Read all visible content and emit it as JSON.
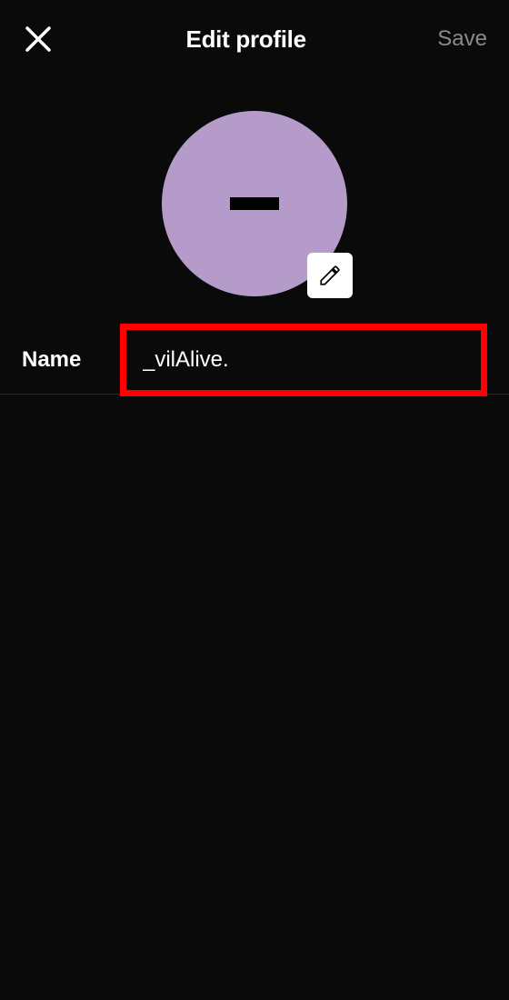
{
  "header": {
    "title": "Edit profile",
    "save_label": "Save"
  },
  "avatar": {
    "color": "#b49bc9"
  },
  "form": {
    "name_label": "Name",
    "name_value": "_vilAlive."
  }
}
